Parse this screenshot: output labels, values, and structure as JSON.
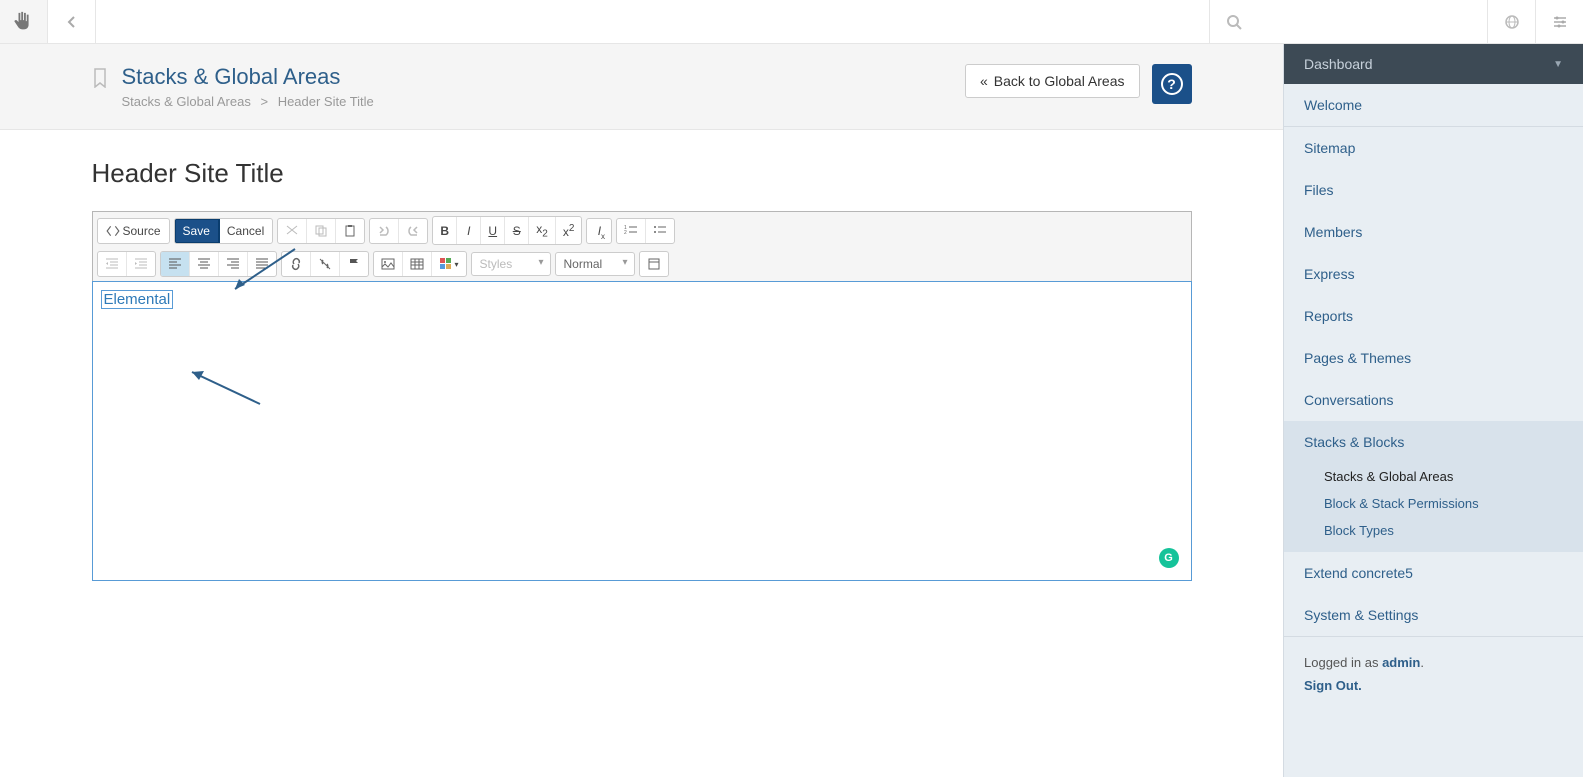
{
  "topbar": {
    "back_icon": "arrow-left"
  },
  "header": {
    "title": "Stacks & Global Areas",
    "crumb1": "Stacks & Global Areas",
    "crumb2": "Header Site Title",
    "back_btn": "Back to Global Areas",
    "help": "?"
  },
  "content": {
    "h1": "Header Site Title",
    "editor_text": "Elemental",
    "grammarly": "G"
  },
  "toolbar": {
    "source": "Source",
    "save": "Save",
    "cancel": "Cancel",
    "styles": "Styles",
    "format": "Normal"
  },
  "sidebar": {
    "header": "Dashboard",
    "welcome": "Welcome",
    "items": [
      {
        "label": "Sitemap"
      },
      {
        "label": "Files"
      },
      {
        "label": "Members"
      },
      {
        "label": "Express"
      },
      {
        "label": "Reports"
      },
      {
        "label": "Pages & Themes"
      },
      {
        "label": "Conversations"
      }
    ],
    "stacks": {
      "label": "Stacks & Blocks",
      "sub": [
        {
          "label": "Stacks & Global Areas",
          "current": true
        },
        {
          "label": "Block & Stack Permissions"
        },
        {
          "label": "Block Types"
        }
      ]
    },
    "extend": "Extend concrete5",
    "system": "System & Settings",
    "footer_prefix": "Logged in as ",
    "footer_user": "admin",
    "footer_suffix": ".",
    "signout": "Sign Out."
  }
}
